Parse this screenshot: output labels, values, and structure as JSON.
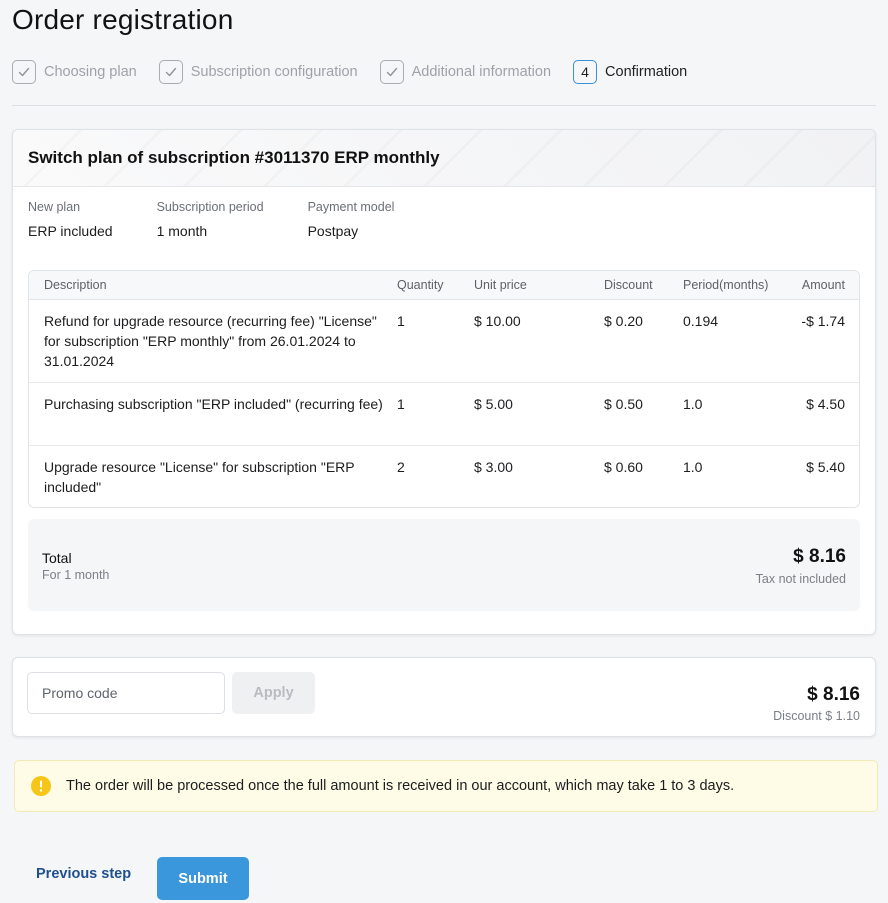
{
  "page": {
    "title": "Order registration"
  },
  "steps": [
    {
      "label": "Choosing plan",
      "state": "done",
      "number": ""
    },
    {
      "label": "Subscription configuration",
      "state": "done",
      "number": ""
    },
    {
      "label": "Additional information",
      "state": "done",
      "number": ""
    },
    {
      "label": "Confirmation",
      "state": "current",
      "number": "4"
    }
  ],
  "order": {
    "title": "Switch plan of subscription #3011370 ERP monthly",
    "info": {
      "new_plan_label": "New plan",
      "new_plan_value": "ERP included",
      "period_label": "Subscription period",
      "period_value": "1 month",
      "payment_label": "Payment model",
      "payment_value": "Postpay"
    },
    "table": {
      "headers": {
        "description": "Description",
        "quantity": "Quantity",
        "unit_price": "Unit price",
        "discount": "Discount",
        "period": "Period(months)",
        "amount": "Amount"
      },
      "rows": [
        {
          "description": "Refund for upgrade resource (recurring fee) \"License\" for subscription \"ERP monthly\" from 26.01.2024 to 31.01.2024",
          "quantity": "1",
          "unit_price": "$ 10.00",
          "discount": "$ 0.20",
          "period": "0.194",
          "amount": "-$ 1.74"
        },
        {
          "description": "Purchasing subscription \"ERP included\" (recurring fee)",
          "quantity": "1",
          "unit_price": "$ 5.00",
          "discount": "$ 0.50",
          "period": "1.0",
          "amount": "$ 4.50"
        },
        {
          "description": "Upgrade resource \"License\" for subscription \"ERP included\"",
          "quantity": "2",
          "unit_price": "$ 3.00",
          "discount": "$ 0.60",
          "period": "1.0",
          "amount": "$ 5.40"
        }
      ]
    },
    "total": {
      "label": "Total",
      "sub": "For 1 month",
      "amount": "$ 8.16",
      "tax_note": "Tax not included"
    }
  },
  "promo": {
    "placeholder": "Promo code",
    "apply_label": "Apply",
    "amount": "$ 8.16",
    "discount": "Discount $ 1.10"
  },
  "notice": {
    "text": "The order will be processed once the full amount is received in our account, which may take 1 to 3 days."
  },
  "actions": {
    "previous_label": "Previous step",
    "submit_label": "Submit"
  },
  "colors": {
    "accent": "#3a97dc",
    "link": "#1f4f8c",
    "notice_bg": "#fefbe6",
    "notice_icon": "#f5c518"
  }
}
